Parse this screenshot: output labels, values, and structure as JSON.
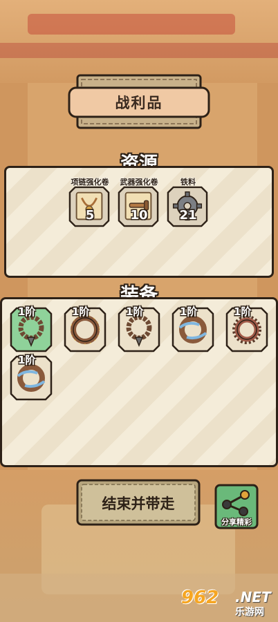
{
  "title": "战利品",
  "resources": {
    "heading": "资源",
    "items": [
      {
        "label": "项链强化卷",
        "count": "5",
        "icon": "necklace-scroll-icon"
      },
      {
        "label": "武器强化卷",
        "count": "10",
        "icon": "weapon-scroll-icon"
      },
      {
        "label": "铁料",
        "count": "21",
        "icon": "iron-gear-icon"
      }
    ]
  },
  "equipment": {
    "heading": "装备",
    "items": [
      {
        "tier": "1阶",
        "icon": "bead-necklace-icon",
        "rarity_color": "#8fd29a"
      },
      {
        "tier": "1阶",
        "icon": "wood-ring-icon",
        "rarity_color": "#ece1ca"
      },
      {
        "tier": "1阶",
        "icon": "bead-necklace-icon",
        "rarity_color": "#ece1ca"
      },
      {
        "tier": "1阶",
        "icon": "wind-ring-icon",
        "rarity_color": "#ece1ca"
      },
      {
        "tier": "1阶",
        "icon": "spiked-ring-icon",
        "rarity_color": "#ece1ca"
      },
      {
        "tier": "1阶",
        "icon": "wind-ring-icon",
        "rarity_color": "#ece1ca"
      }
    ]
  },
  "buttons": {
    "end_and_take": "结束并带走",
    "share": "分享精彩"
  },
  "watermark": {
    "number": "962",
    "net": ".NET",
    "sub": "乐游网"
  }
}
